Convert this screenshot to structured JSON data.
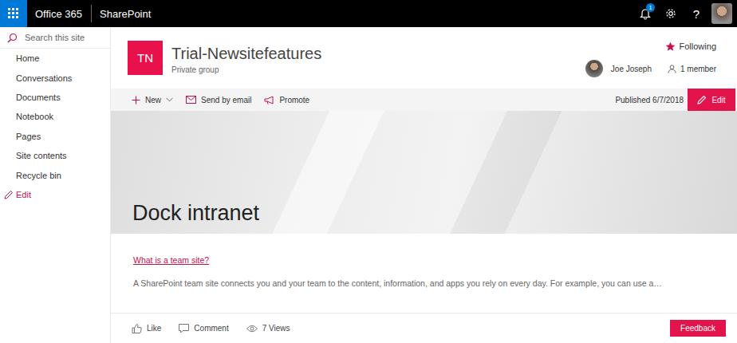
{
  "topbar": {
    "brand": "Office 365",
    "app": "SharePoint",
    "notifications": "1",
    "help": "?"
  },
  "sidebar": {
    "search_placeholder": "Search this site",
    "items": [
      {
        "label": "Home",
        "kind": "link"
      },
      {
        "label": "Conversations",
        "kind": "link"
      },
      {
        "label": "Documents",
        "kind": "link"
      },
      {
        "label": "Notebook",
        "kind": "link"
      },
      {
        "label": "Pages",
        "kind": "link"
      },
      {
        "label": "Site contents",
        "kind": "link"
      },
      {
        "label": "Recycle bin",
        "kind": "link"
      },
      {
        "label": "Edit",
        "kind": "edit"
      }
    ]
  },
  "site": {
    "logo": "TN",
    "title": "Trial-Newsitefeatures",
    "subtitle": "Private group",
    "following": "Following",
    "followed": true,
    "owner": "Joe Joseph",
    "members": "1 member"
  },
  "command_bar": {
    "commands": [
      {
        "label": "New",
        "kind": "new"
      },
      {
        "label": "Send by email",
        "kind": "email"
      },
      {
        "label": "Promote",
        "kind": "promote"
      }
    ],
    "published": "Published 6/7/2018",
    "edit": "Edit"
  },
  "hero": {
    "title": "Dock intranet"
  },
  "content": {
    "link": "What is a team site?",
    "text": "A SharePoint team site connects you and your team to the content, information, and apps you rely on every day. For example, you can use a…"
  },
  "footer": {
    "actions": [
      {
        "label": "Like",
        "kind": "like"
      },
      {
        "label": "Comment",
        "kind": "comment"
      },
      {
        "label": "7 Views",
        "kind": "views"
      }
    ],
    "feedback": "Feedback"
  }
}
